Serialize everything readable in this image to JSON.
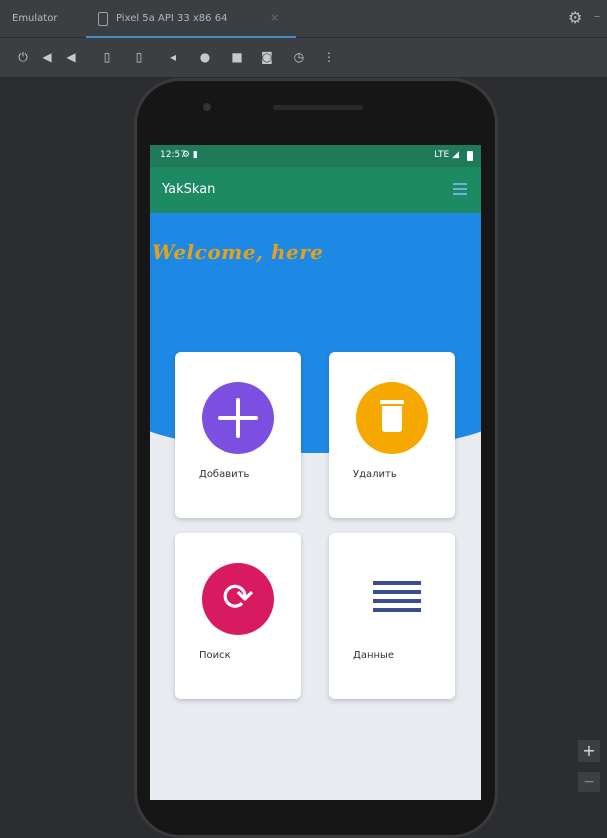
{
  "ide": {
    "panel_title": "Emulator",
    "tab_label": "Pixel 5a API 33 x86 64",
    "tab_close": "×",
    "settings_icon": "gear-icon",
    "toolbar_icons": [
      "power-icon",
      "volume-up-icon",
      "volume-down-icon",
      "rotate-left-icon",
      "rotate-right-icon",
      "back-icon",
      "home-icon",
      "overview-icon",
      "camera-icon",
      "snapshot-icon",
      "more-icon"
    ]
  },
  "device": {
    "status_time": "12:57",
    "status_icons": "⚙ ▮",
    "network": "LTE ◢",
    "app_title": "YakSkan",
    "welcome_text": "Welcome, here",
    "cards": [
      {
        "label": "Добавить",
        "icon": "add-icon",
        "color": "#7b4fe0"
      },
      {
        "label": "Удалить",
        "icon": "trash-icon",
        "color": "#f5a800"
      },
      {
        "label": "Поиск",
        "icon": "search-refresh-icon",
        "color": "#d81b60"
      },
      {
        "label": "Данные",
        "icon": "data-list-icon",
        "color": "#3b4f8f"
      }
    ]
  },
  "zoom": {
    "plus": "+",
    "minus": "−"
  },
  "colors": {
    "appbar": "#1e8a64",
    "hero": "#1e88e5",
    "welcome": "#e4a11b"
  }
}
